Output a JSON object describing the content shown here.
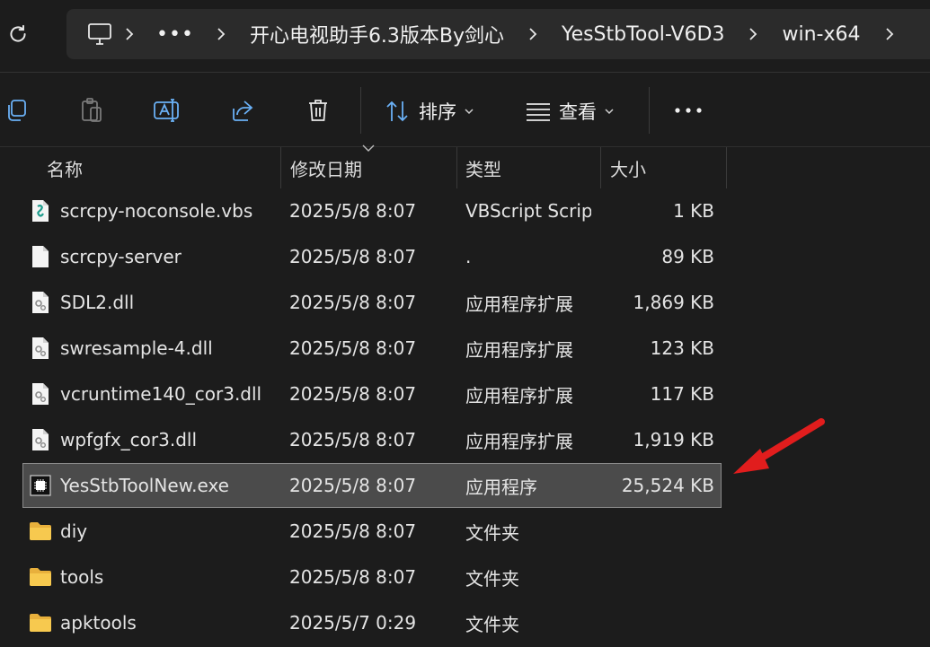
{
  "breadcrumb": {
    "items": [
      "开心电视助手6.3版本By剑心",
      "YesStbTool-V6D3",
      "win-x64"
    ]
  },
  "toolbar": {
    "sort_label": "排序",
    "view_label": "查看"
  },
  "columns": {
    "name": "名称",
    "date": "修改日期",
    "type": "类型",
    "size": "大小"
  },
  "files": [
    {
      "name": "scrcpy-noconsole.vbs",
      "date": "2025/5/8 8:07",
      "type": "VBScript Script File",
      "size": "1 KB",
      "icon": "vbs-script-icon"
    },
    {
      "name": "scrcpy-server",
      "date": "2025/5/8 8:07",
      "type": ".",
      "size": "89 KB",
      "icon": "blank-file-icon"
    },
    {
      "name": "SDL2.dll",
      "date": "2025/5/8 8:07",
      "type": "应用程序扩展",
      "size": "1,869 KB",
      "icon": "dll-file-icon"
    },
    {
      "name": "swresample-4.dll",
      "date": "2025/5/8 8:07",
      "type": "应用程序扩展",
      "size": "123 KB",
      "icon": "dll-file-icon"
    },
    {
      "name": "vcruntime140_cor3.dll",
      "date": "2025/5/8 8:07",
      "type": "应用程序扩展",
      "size": "117 KB",
      "icon": "dll-file-icon"
    },
    {
      "name": "wpfgfx_cor3.dll",
      "date": "2025/5/8 8:07",
      "type": "应用程序扩展",
      "size": "1,919 KB",
      "icon": "dll-file-icon"
    },
    {
      "name": "YesStbToolNew.exe",
      "date": "2025/5/8 8:07",
      "type": "应用程序",
      "size": "25,524 KB",
      "icon": "exe-file-icon",
      "selected": true
    },
    {
      "name": "diy",
      "date": "2025/5/8 8:07",
      "type": "文件夹",
      "size": "",
      "icon": "folder-icon"
    },
    {
      "name": "tools",
      "date": "2025/5/8 8:07",
      "type": "文件夹",
      "size": "",
      "icon": "folder-icon"
    },
    {
      "name": "apktools",
      "date": "2025/5/7 0:29",
      "type": "文件夹",
      "size": "",
      "icon": "folder-icon"
    }
  ],
  "colors": {
    "background": "#1c1c1c",
    "address_bar": "#2b2b2b",
    "selection": "#4b4b4b",
    "annotation_arrow": "#e11d1d",
    "folder": "#f2c14e"
  }
}
